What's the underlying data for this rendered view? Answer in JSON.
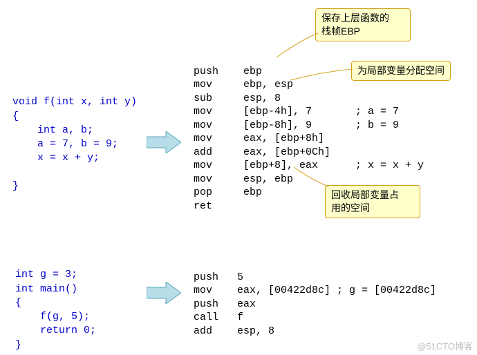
{
  "callout1": {
    "line1": "保存上层函数的",
    "line2": "栈帧EBP"
  },
  "callout2": {
    "text": "为局部变量分配空间"
  },
  "callout3": {
    "line1": "回收局部变量占",
    "line2": "用的空间"
  },
  "source_f": {
    "l1": "void f(int x, int y)",
    "l2": "{",
    "l3": "    int a, b;",
    "l4": "    a = 7, b = 9;",
    "l5": "    x = x + y;",
    "l6": "}"
  },
  "asm_f": {
    "l1": "push    ebp",
    "l2": "mov     ebp, esp",
    "l3": "sub     esp, 8",
    "l4": "mov     [ebp-4h], 7       ; a = 7",
    "l5": "mov     [ebp-8h], 9       ; b = 9",
    "l6": "mov     eax, [ebp+8h]",
    "l7": "add     eax, [ebp+0Ch]",
    "l8": "mov     [ebp+8], eax      ; x = x + y",
    "l9": "mov     esp, ebp",
    "l10": "pop     ebp",
    "l11": "ret"
  },
  "source_main": {
    "l1": "int g = 3;",
    "l2": "int main()",
    "l3": "{",
    "l4": "    f(g, 5);",
    "l5": "    return 0;",
    "l6": "}"
  },
  "asm_main": {
    "l1": "push   5",
    "l2": "mov    eax, [00422d8c] ; g = [00422d8c]",
    "l3": "push   eax",
    "l4": "call   f",
    "l5": "add    esp, 8"
  },
  "watermark": "@51CTO博客"
}
